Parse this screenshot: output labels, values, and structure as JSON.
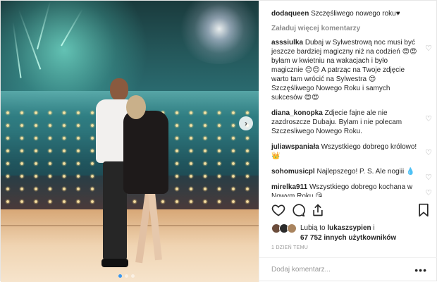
{
  "post": {
    "author": "dodaqueen",
    "caption": "Szczęśliwego nowego roku",
    "caption_heart": "♥"
  },
  "load_more": "Załaduj więcej komentarzy",
  "comments": [
    {
      "user": "asssiulka",
      "text": "Dubaj w Sylwestrową noc musi być jeszcze bardziej magiczny niż na codzień 😍😍 byłam w kwietniu na wakacjach i było magicznie 😊😊 A patrząc na Twoje zdjęcie warto tam wrócić na Sylwestra 😍 Szczęśliwego Nowego Roku i samych sukcesów 😍😍"
    },
    {
      "user": "diana_konopka",
      "text": "Zdjecie fajne ale nie zazdroszcze Dubaju. Bylam i nie polecam Szczesliwego Nowego Roku."
    },
    {
      "user": "juliawspaniała",
      "text": "Wszystkiego dobrego królowo!👑"
    },
    {
      "user": "sohomusicpl",
      "text": "Najlepszego! P. S. Ale nogiii 💧"
    },
    {
      "user": "mirelka911",
      "text": "Wszystkiego dobrego kochana w Nowym Roku 😘"
    }
  ],
  "likes": {
    "prefix": "Lubią to",
    "first_user": "lukaszsypien",
    "connector": "i",
    "count_text": "67 752 innych użytkowników"
  },
  "time_text": "1 DZIEŃ TEMU",
  "add_comment": {
    "placeholder": "Dodaj komentarz..."
  },
  "icons": {
    "comment_like": "heart-outline-icon",
    "more": "more-options-icon"
  },
  "colors": {
    "active_dot": "#3897f0",
    "muted_text": "#8e8e8e"
  }
}
